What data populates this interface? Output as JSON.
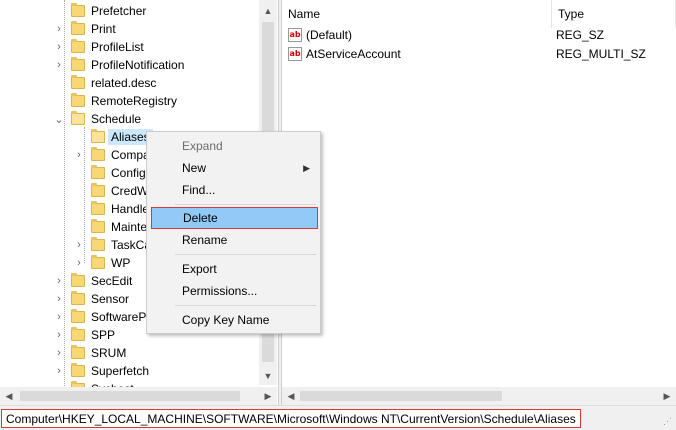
{
  "tree": {
    "items": [
      {
        "label": "Prefetcher",
        "expander": ""
      },
      {
        "label": "Print",
        "expander": "›"
      },
      {
        "label": "ProfileList",
        "expander": "›"
      },
      {
        "label": "ProfileNotification",
        "expander": "›"
      },
      {
        "label": "related.desc",
        "expander": ""
      },
      {
        "label": "RemoteRegistry",
        "expander": ""
      },
      {
        "label": "Schedule",
        "expander": "⌄"
      },
      {
        "label": "Aliases",
        "expander": ""
      },
      {
        "label": "Compa",
        "expander": "›"
      },
      {
        "label": "Config",
        "expander": ""
      },
      {
        "label": "CredW",
        "expander": ""
      },
      {
        "label": "Handle",
        "expander": ""
      },
      {
        "label": "Mainte",
        "expander": ""
      },
      {
        "label": "TaskCa",
        "expander": "›"
      },
      {
        "label": "WP",
        "expander": "›"
      },
      {
        "label": "SecEdit",
        "expander": "›"
      },
      {
        "label": "Sensor",
        "expander": "›"
      },
      {
        "label": "SoftwarePr",
        "expander": "›"
      },
      {
        "label": "SPP",
        "expander": "›"
      },
      {
        "label": "SRUM",
        "expander": "›"
      },
      {
        "label": "Superfetch",
        "expander": "›"
      },
      {
        "label": "Svchost",
        "expander": ""
      }
    ]
  },
  "list": {
    "columns": {
      "name": "Name",
      "type": "Type"
    },
    "rows": [
      {
        "icon": "ab",
        "name": "(Default)",
        "type": "REG_SZ"
      },
      {
        "icon": "ab",
        "name": "AtServiceAccount",
        "type": "REG_MULTI_SZ"
      }
    ]
  },
  "context_menu": {
    "expand": "Expand",
    "new": "New",
    "find": "Find...",
    "delete": "Delete",
    "rename": "Rename",
    "export": "Export",
    "permissions": "Permissions...",
    "copy_key_name": "Copy Key Name"
  },
  "status_bar": {
    "path": "Computer\\HKEY_LOCAL_MACHINE\\SOFTWARE\\Microsoft\\Windows NT\\CurrentVersion\\Schedule\\Aliases"
  },
  "scroll_icons": {
    "up": "▲",
    "down": "▼",
    "left": "◀",
    "right": "▶"
  },
  "colors": {
    "highlight": "#91c9f7",
    "red_outline": "#d83a3a",
    "folder": "#f8d775"
  }
}
